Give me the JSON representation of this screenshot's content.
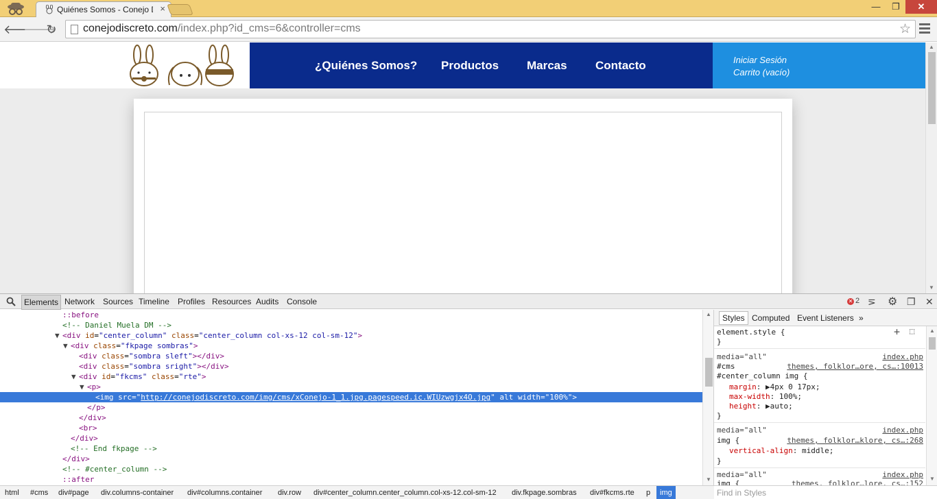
{
  "browser": {
    "tab_title": "Quiénes Somos - Conejo D",
    "tab_close": "×",
    "win_min": "—",
    "win_max": "❐",
    "win_close": "✕",
    "url_domain": "conejodiscreto.com",
    "url_rest": "/index.php?id_cms=6&controller=cms",
    "back": "🡐",
    "forward": "🡒",
    "reload": "↻",
    "star": "☆"
  },
  "site": {
    "nav": [
      "¿Quiénes Somos?",
      "Productos",
      "Marcas",
      "Contacto"
    ],
    "login": "Iniciar Sesión",
    "cart": "Carrito (vacío)",
    "colors": {
      "nav_bg": "#0a2b8c",
      "account_bg": "#1e8fe0"
    }
  },
  "devtools": {
    "tabs": [
      "Elements",
      "Network",
      "Sources",
      "Timeline",
      "Profiles",
      "Resources",
      "Audits",
      "Console"
    ],
    "error_count": "2",
    "dom": {
      "l0": "::before",
      "l1": "<!-- Daniel Muela DM -->",
      "l2_tag": "div",
      "l2_id_attr": "id",
      "l2_id": "\"center_column\"",
      "l2_class_attr": "class",
      "l2_class": "\"center_column col-xs-12 col-sm-12\"",
      "l3_tag": "div",
      "l3_class_attr": "class",
      "l3_class": "\"fkpage sombras\"",
      "l4_tag": "div",
      "l4_class_attr": "class",
      "l4_class": "\"sombra sleft\"",
      "l4_close": "</div>",
      "l5_tag": "div",
      "l5_class_attr": "class",
      "l5_class": "\"sombra sright\"",
      "l5_close": "</div>",
      "l6_tag": "div",
      "l6_id_attr": "id",
      "l6_id": "\"fkcms\"",
      "l6_class_attr": "class",
      "l6_class": "\"rte\"",
      "l7": "<p>",
      "l8_pre": "<img src=\"",
      "l8_src": "http://conejodiscreto.com/img/cms/xConejo-1_1.jpg.pagespeed.ic.WIUzwgjx4O.jpg",
      "l8_post": "\" alt width=\"100%\">",
      "l9": "</p>",
      "l10": "</div>",
      "l11": "<br>",
      "l12": "</div>",
      "l13": "<!-- End fkpage -->",
      "l14": "</div>",
      "l15": "<!-- #center_column -->",
      "l16": "::after"
    },
    "styles_tabs": [
      "Styles",
      "Computed",
      "Event Listeners",
      "»"
    ],
    "styles": {
      "element_style": "element.style {",
      "close": "}",
      "media": "media=\"all\"",
      "src_index": "index.php",
      "r1_sel_a": "#cms",
      "r1_src": "themes, folklor…ore, cs…:10013",
      "r1_sel_b": "#center_column img {",
      "r1_p1": "margin",
      "r1_v1": "4px 0 17px;",
      "r1_p2": "max-width",
      "r1_v2": "100%;",
      "r1_p3": "height",
      "r1_v3": "auto;",
      "r2_sel": "img {",
      "r2_src": "themes, folklor…klore, cs…:268",
      "r2_p1": "vertical-align",
      "r2_v1": "middle;",
      "r3_sel": "img {",
      "r3_src": "themes, folklor…lore, cs…:152",
      "find_placeholder": "Find in Styles"
    },
    "breadcrumbs": [
      "html",
      "#cms",
      "div#page",
      "div.columns-container",
      "div#columns.container",
      "div.row",
      "div#center_column.center_column.col-xs-12.col-sm-12",
      "div.fkpage.sombras",
      "div#fkcms.rte",
      "p",
      "img"
    ]
  }
}
